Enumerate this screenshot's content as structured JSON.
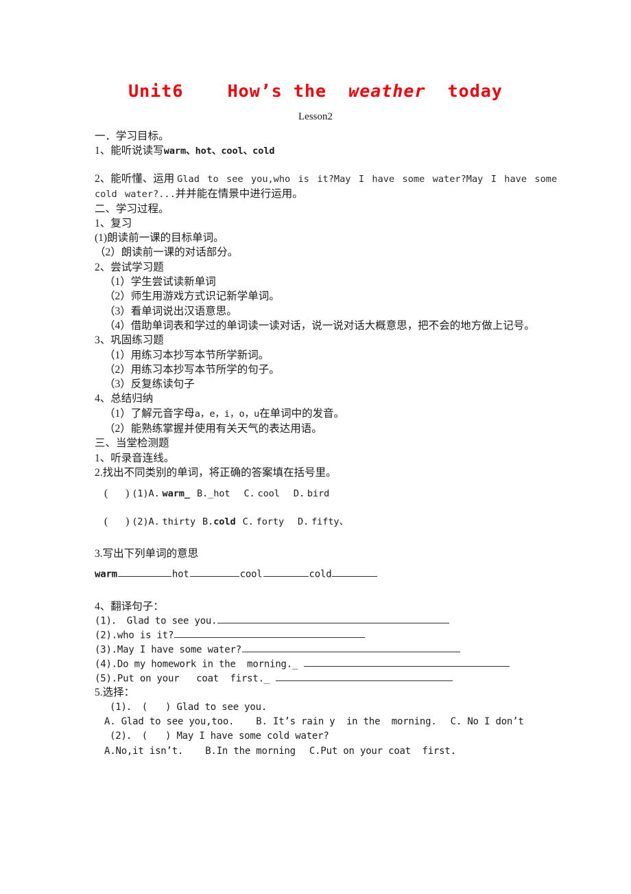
{
  "title": {
    "pre": "Unit6    How’s the  ",
    "italic_word": "weather",
    "post": "  today",
    "color": "#fb0007",
    "subtitle": "Lesson2"
  },
  "sections": {
    "goals_heading": "一．学习目标。",
    "goal1_prefix": "1、能听说读写",
    "goal1_words": "warm、hot、cool、cold",
    "goal2_prefix": "2、能听懂、运用 ",
    "goal2_english": "Glad to see you,who is it?May I have some water?May I have some cold water?...",
    "goal2_suffix": "并并能在情景中进行运用。",
    "process_heading": "二、学习过程。",
    "review_heading": "1、复习",
    "review_items": [
      "(1)朗读前一课的目标单词。",
      "（2）朗读前一课的对话部分。"
    ],
    "try_heading": "2、尝试学习题",
    "try_items": [
      "（1）学生尝试读新单词",
      "（2）师生用游戏方式识记新学单词。",
      "（3）看单词说出汉语意思。",
      "（4）借助单词表和学过的单词读一读对话，说一说对话大概意思，把不会的地方做上记号。"
    ],
    "consolidate_heading": "3、巩固练习题",
    "consolidate_items": [
      "（1）用练习本抄写本节所学新词。",
      "（2）用练习本抄写本节所学的句子。",
      "（3）反复练读句子"
    ],
    "summary_heading": "4、总结归纳",
    "summary_item1_pre": "（1）了解元音字母",
    "summary_item1_letters": "a，e，i，o，u",
    "summary_item1_post": "在单词中的发音。",
    "summary_item2": "（2）能熟练掌握并使用有关天气的表达用语。",
    "test_heading": "三、当堂检测题",
    "test_q1": "1、听录音连线。",
    "test_q2": "2.找出不同类别的单词，将正确的答案填在括号里。"
  },
  "odd_one_out": [
    {
      "number": "(1)",
      "options": [
        {
          "label": "A.",
          "text": "warm_",
          "bold": true
        },
        {
          "label": "B.",
          "text": "_hot",
          "bold": false
        },
        {
          "label": "C.",
          "text": "cool",
          "bold": false
        },
        {
          "label": "D.",
          "text": "bird",
          "bold": false
        }
      ]
    },
    {
      "number": "(2)",
      "options": [
        {
          "label": "A.",
          "text": "thirty",
          "bold": false
        },
        {
          "label": "B.",
          "text": "cold",
          "bold": true
        },
        {
          "label": "C.",
          "text": "forty",
          "bold": false
        },
        {
          "label": "D.",
          "text": "fifty、",
          "bold": false
        }
      ]
    }
  ],
  "meanings": {
    "heading": "3.写出下列单词的意思",
    "words": [
      "warm",
      "hot",
      "cool",
      "cold"
    ]
  },
  "translate": {
    "heading": "4、翻译句子：",
    "items": [
      {
        "num": "(1)．",
        "sentence": "Glad to see you."
      },
      {
        "num": "(2).",
        "sentence": "who is it?"
      },
      {
        "num": "(3).",
        "sentence": "May I have some water?"
      },
      {
        "num": "(4).",
        "sentence": "Do my homework in the  morning._"
      },
      {
        "num": "(5).",
        "sentence": "Put on your   coat  first._"
      }
    ]
  },
  "choice": {
    "heading": "5.选择：",
    "questions": [
      {
        "num": "(1)．",
        "stem": "Glad to see you.",
        "options": [
          {
            "label": "A.",
            "text": "Glad to see you,too."
          },
          {
            "label": "B.",
            "text": "It’s rain y  in the  morning."
          },
          {
            "label": "C.",
            "text": "No I don’t"
          }
        ]
      },
      {
        "num": "(2)．",
        "stem": "May I have some cold water?",
        "options": [
          {
            "label": "A.",
            "text": "No,it isn’t."
          },
          {
            "label": "B.",
            "text": "In the morning"
          },
          {
            "label": "C.",
            "text": "Put on your coat  first."
          }
        ]
      }
    ]
  }
}
